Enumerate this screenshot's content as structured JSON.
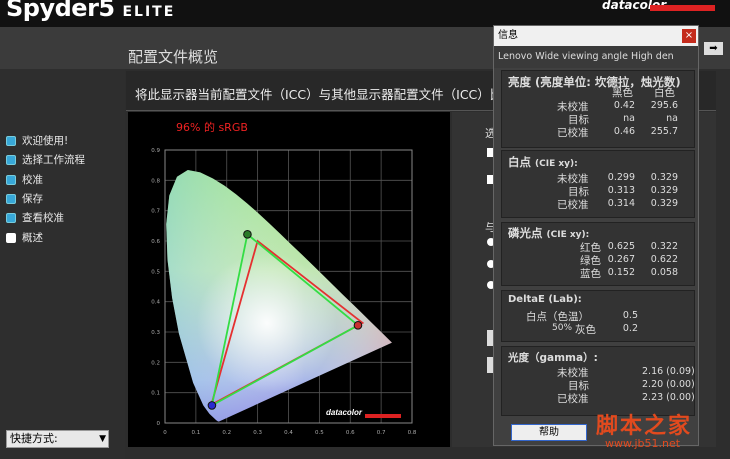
{
  "app": {
    "logo_main": "Spyder5",
    "logo_sub": "ELITE",
    "brand": "datacolor"
  },
  "page_title": "配置文件概览",
  "sidebar": {
    "items": [
      {
        "label": "欢迎使用!"
      },
      {
        "label": "选择工作流程"
      },
      {
        "label": "校准"
      },
      {
        "label": "保存"
      },
      {
        "label": "查看校准"
      },
      {
        "label": "概述"
      }
    ],
    "quick_label": "快捷方式:"
  },
  "content": {
    "header_text": "将此显示器当前配置文件（ICC）与其他显示器配置文件（ICC）比",
    "srgb_coverage": "96% 的 sRGB",
    "chart_brand": "datacolor"
  },
  "right_panel": {
    "label1": "选",
    "label2": "与"
  },
  "chart_data": {
    "type": "scatter",
    "title": "",
    "x_ticks": [
      "0",
      "0.1",
      "0.2",
      "0.3",
      "0.4",
      "0.5",
      "0.6",
      "0.7",
      "0.8"
    ],
    "y_ticks": [
      "0",
      "0.1",
      "0.2",
      "0.3",
      "0.4",
      "0.5",
      "0.6",
      "0.7",
      "0.8",
      "0.9"
    ],
    "xlim": [
      0,
      0.8
    ],
    "ylim": [
      0,
      0.9
    ],
    "series": [
      {
        "name": "",
        "color": "#e53030",
        "points": [
          [
            0.64,
            0.33
          ],
          [
            0.3,
            0.6
          ],
          [
            0.15,
            0.06
          ]
        ]
      },
      {
        "name": "",
        "color": "#33dd44",
        "points": [
          [
            0.625,
            0.322
          ],
          [
            0.267,
            0.622
          ],
          [
            0.152,
            0.058
          ]
        ]
      }
    ]
  },
  "popup": {
    "title": "信息",
    "close": "×",
    "subtitle": "Lenovo Wide viewing angle  High den",
    "brightness": {
      "title": "亮度 (亮度单位:  坎德拉，烛光数)",
      "col_black": "黑色",
      "col_white": "白色",
      "rows": [
        {
          "label": "未校准",
          "black": "0.42",
          "white": "295.6"
        },
        {
          "label": "目标",
          "black": "na",
          "white": "na"
        },
        {
          "label": "已校准",
          "black": "0.46",
          "white": "255.7"
        }
      ]
    },
    "whitepoint": {
      "title": "白点",
      "title_suffix": "(CIE xy):",
      "rows": [
        {
          "label": "未校准",
          "x": "0.299",
          "y": "0.329"
        },
        {
          "label": "目标",
          "x": "0.313",
          "y": "0.329"
        },
        {
          "label": "已校准",
          "x": "0.314",
          "y": "0.329"
        }
      ]
    },
    "phosphor": {
      "title": "磷光点",
      "title_suffix": "(CIE xy):",
      "rows": [
        {
          "label": "红色",
          "x": "0.625",
          "y": "0.322"
        },
        {
          "label": "绿色",
          "x": "0.267",
          "y": "0.622"
        },
        {
          "label": "蓝色",
          "x": "0.152",
          "y": "0.058"
        }
      ]
    },
    "deltae": {
      "title": "DeltaE (Lab):",
      "rows": [
        {
          "label": "白点（色温）",
          "value": "0.5"
        },
        {
          "label": "灰色",
          "prefix": "50%",
          "value": "0.2"
        }
      ]
    },
    "gamma": {
      "title": "光度（gamma）:",
      "rows": [
        {
          "label": "未校准",
          "value": "2.16 (0.09)"
        },
        {
          "label": "目标",
          "value": "2.20 (0.00)"
        },
        {
          "label": "已校准",
          "value": "2.23 (0.00)"
        }
      ]
    },
    "help_button": "帮助"
  },
  "watermark": {
    "main": "脚本之家",
    "url": "www.jb51.net"
  }
}
